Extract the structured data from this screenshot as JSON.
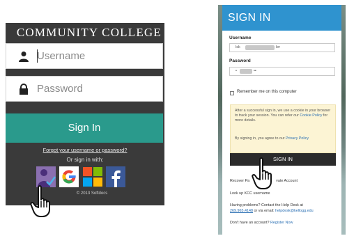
{
  "left": {
    "college_name": "COMMUNITY COLLEGE",
    "username_placeholder": "Username",
    "password_placeholder": "Password",
    "signin_label": "Sign In",
    "forgot_link": "Forgot your username or password?",
    "or_signin_with": "Or sign in with:",
    "social": [
      {
        "name": "person-check-icon"
      },
      {
        "name": "google-icon",
        "letter": "G"
      },
      {
        "name": "microsoft-icon"
      },
      {
        "name": "facebook-icon",
        "letter": "f"
      }
    ],
    "copyright": "© 2013 Softdocs",
    "colors": {
      "panel_bg": "#3a3a3a",
      "button": "#2a9a8c"
    }
  },
  "right": {
    "header": "SIGN IN",
    "username_label": "Username",
    "username_prefix": "lsk",
    "username_suffix": "ler",
    "password_label": "Password",
    "password_start": "•",
    "password_end": "••",
    "remember_label": "Remember me on this computer",
    "info_text_1a": "After a successful sign in, we use a cookie in your browser to track your session. You can refer our ",
    "info_link_1": "Cookie Policy",
    "info_text_1b": " for more details.",
    "info_text_2a": "By signing in, you agree to our ",
    "info_link_2": "Privacy Policy",
    "signin_label": "SIGN IN",
    "recover_left": "Recover Pa",
    "recover_right": "vate Account",
    "lookup": "Look up KCC username",
    "help_prefix": "Having problems? Contact the Help Desk at",
    "help_phone": "269.965.4148",
    "help_mid": " or via email: ",
    "help_email": "helpdesk@kellogg.edu",
    "no_account": "Don't have an account? ",
    "register": "Register Now",
    "colors": {
      "header": "#2f93cf",
      "button": "#2b2b2b",
      "info_bg": "#fcf4d4"
    }
  }
}
